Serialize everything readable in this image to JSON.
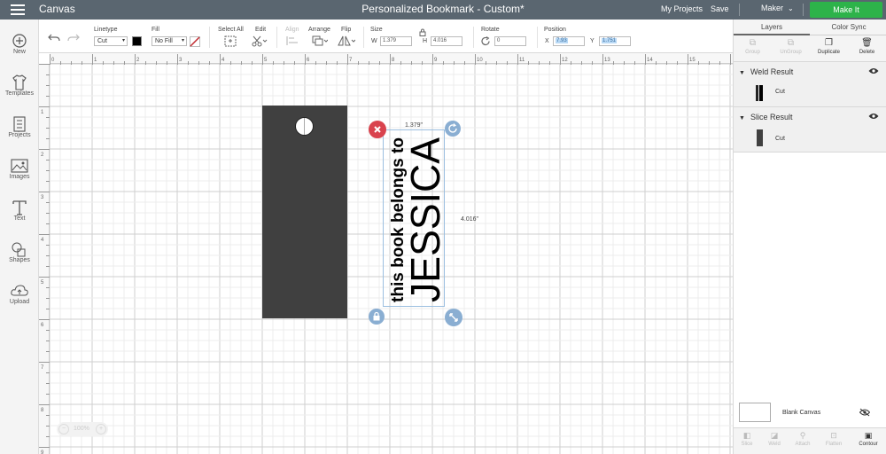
{
  "header": {
    "app_title": "Canvas",
    "document_title": "Personalized Bookmark - Custom*",
    "my_projects": "My Projects",
    "save": "Save",
    "machine": "Maker",
    "make_it": "Make It"
  },
  "toolbar": {
    "undo_icon": "undo-icon",
    "redo_icon": "redo-icon",
    "linetype_label": "Linetype",
    "linetype_value": "Cut",
    "fill_label": "Fill",
    "fill_value": "No Fill",
    "select_all_label": "Select All",
    "edit_label": "Edit",
    "align_label": "Align",
    "arrange_label": "Arrange",
    "flip_label": "Flip",
    "size_label": "Size",
    "w_label": "W",
    "w_value": "1.379",
    "h_label": "H",
    "h_value": "4.016",
    "rotate_label": "Rotate",
    "rotate_value": "0",
    "position_label": "Position",
    "x_label": "X",
    "x_value": "7.93",
    "y_label": "Y",
    "y_value": "1.751"
  },
  "sidebar": {
    "items": [
      {
        "label": "New",
        "icon": "plus-circle-icon"
      },
      {
        "label": "Templates",
        "icon": "tshirt-icon"
      },
      {
        "label": "Projects",
        "icon": "projects-icon"
      },
      {
        "label": "Images",
        "icon": "image-icon"
      },
      {
        "label": "Text",
        "icon": "text-icon"
      },
      {
        "label": "Shapes",
        "icon": "shapes-icon"
      },
      {
        "label": "Upload",
        "icon": "upload-icon"
      }
    ]
  },
  "canvas": {
    "ruler_top": [
      "0",
      "1",
      "2",
      "3",
      "4",
      "5",
      "6",
      "7",
      "8",
      "9",
      "10",
      "11",
      "12",
      "13",
      "14",
      "15"
    ],
    "ruler_left": [
      "1",
      "2",
      "3",
      "4",
      "5",
      "6",
      "7",
      "8",
      "9"
    ],
    "selection_width_label": "1.379\"",
    "selection_height_label": "4.016\"",
    "text_line1": "this book belongs to",
    "text_line2": "JESSICA",
    "zoom_value": "100%",
    "zoom_minus": "−",
    "zoom_plus": "+"
  },
  "panel": {
    "tabs": [
      "Layers",
      "Color Sync"
    ],
    "actions": [
      {
        "label": "Group",
        "icon": "group-icon",
        "enabled": false
      },
      {
        "label": "UnGroup",
        "icon": "ungroup-icon",
        "enabled": false
      },
      {
        "label": "Duplicate",
        "icon": "duplicate-icon",
        "enabled": true
      },
      {
        "label": "Delete",
        "icon": "trash-icon",
        "enabled": true
      }
    ],
    "layers": [
      {
        "name": "Weld Result",
        "operation": "Cut"
      },
      {
        "name": "Slice Result",
        "operation": "Cut"
      }
    ],
    "blank_canvas": "Blank Canvas",
    "bottom_actions": [
      {
        "label": "Slice",
        "icon": "slice-icon",
        "enabled": false
      },
      {
        "label": "Weld",
        "icon": "weld-icon",
        "enabled": false
      },
      {
        "label": "Attach",
        "icon": "attach-icon",
        "enabled": false
      },
      {
        "label": "Flatten",
        "icon": "flatten-icon",
        "enabled": false
      },
      {
        "label": "Contour",
        "icon": "contour-icon",
        "enabled": true
      }
    ]
  },
  "colors": {
    "header_bg": "#5a6670",
    "make_it_green": "#2db34a",
    "bookmark_fill": "#404040",
    "delete_handle": "#d9434e",
    "handle_blue": "#8aaed2"
  }
}
